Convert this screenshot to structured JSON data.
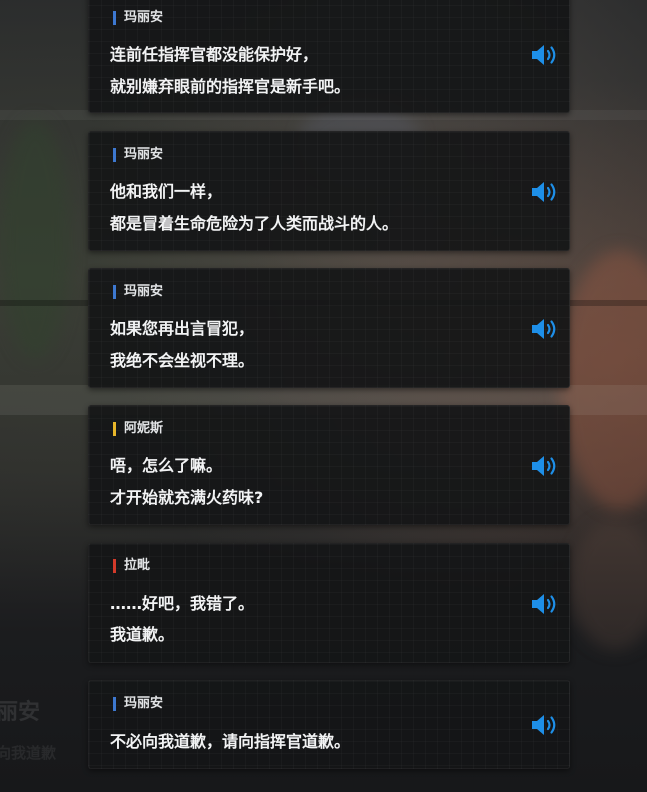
{
  "colors": {
    "accent_blue": "#1e8fe8",
    "speaker_bar_blue": "#3d78d0",
    "speaker_bar_yellow": "#e8b62a",
    "speaker_bar_red": "#d23a2a"
  },
  "icons": {
    "voice": "speaker-icon"
  },
  "background": {
    "ghost_name": "丽安",
    "ghost_line": "向我道歉"
  },
  "dialogue": [
    {
      "speaker": "玛丽安",
      "bar_color": "#3d78d0",
      "lines": [
        "连前任指挥官都没能保护好，",
        "就别嫌弃眼前的指挥官是新手吧。"
      ]
    },
    {
      "speaker": "玛丽安",
      "bar_color": "#3d78d0",
      "lines": [
        "他和我们一样，",
        "都是冒着生命危险为了人类而战斗的人。"
      ]
    },
    {
      "speaker": "玛丽安",
      "bar_color": "#3d78d0",
      "lines": [
        "如果您再出言冒犯，",
        "我绝不会坐视不理。"
      ]
    },
    {
      "speaker": "阿妮斯",
      "bar_color": "#e8b62a",
      "lines": [
        "唔，怎么了嘛。",
        "才开始就充满火药味?"
      ]
    },
    {
      "speaker": "拉毗",
      "bar_color": "#d23a2a",
      "lines": [
        "……好吧，我错了。",
        "我道歉。"
      ]
    },
    {
      "speaker": "玛丽安",
      "bar_color": "#3d78d0",
      "lines": [
        "不必向我道歉，请向指挥官道歉。"
      ]
    }
  ]
}
